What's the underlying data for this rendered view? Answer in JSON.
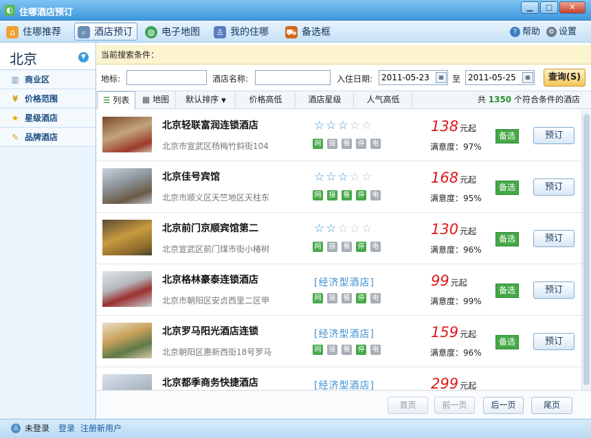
{
  "window": {
    "title": "住哪酒店预订"
  },
  "toolbar": {
    "items": [
      {
        "label": "住哪推荐"
      },
      {
        "label": "酒店预订"
      },
      {
        "label": "电子地图"
      },
      {
        "label": "我的住哪"
      },
      {
        "label": "备选框"
      }
    ],
    "help": "帮助",
    "settings": "设置"
  },
  "sidebar": {
    "city": "北京",
    "items": [
      {
        "label": "商业区"
      },
      {
        "label": "价格范围"
      },
      {
        "label": "星级酒店"
      },
      {
        "label": "品牌酒店"
      }
    ]
  },
  "search": {
    "conditions_label": "当前搜索条件：",
    "landmark_label": "地标:",
    "landmark_value": "",
    "hotel_name_label": "酒店名称:",
    "hotel_name_value": "",
    "checkin_label": "入住日期:",
    "checkin_value": "2011-05-23",
    "to_label": "至",
    "checkout_value": "2011-05-25",
    "button": "查询(S)"
  },
  "tabs": {
    "list": "列表",
    "map": "地图",
    "sort_default": "默认排序",
    "sort_price": "价格高低",
    "sort_star": "酒店星级",
    "sort_popular": "人气高低"
  },
  "result": {
    "prefix": "共",
    "count": "1350",
    "suffix": "个符合条件的酒店"
  },
  "facility_labels": [
    "网",
    "接",
    "餐",
    "停",
    "电"
  ],
  "hotels": [
    {
      "name": "北京轻联富润连锁酒店",
      "address": "北京市宣武区杨梅竹斜街104",
      "stars": 3,
      "type": "",
      "facilities": [
        true,
        false,
        false,
        false,
        false
      ],
      "price": "138",
      "unit": "元起",
      "satisfaction": "满意度：97%",
      "fav": "备选",
      "book": "预订"
    },
    {
      "name": "北京佳号宾馆",
      "address": "北京市顺义区天竺地区天柱东",
      "stars": 3,
      "type": "",
      "facilities": [
        true,
        true,
        true,
        true,
        false
      ],
      "price": "168",
      "unit": "元起",
      "satisfaction": "满意度：95%",
      "fav": "备选",
      "book": "预订"
    },
    {
      "name": "北京前门京顺宾馆第二",
      "address": "北京宣武区前门煤市街小椿树",
      "stars": 2,
      "type": "",
      "facilities": [
        true,
        false,
        false,
        true,
        false
      ],
      "price": "130",
      "unit": "元起",
      "satisfaction": "满意度：96%",
      "fav": "备选",
      "book": "预订"
    },
    {
      "name": "北京格林豪泰连锁酒店",
      "address": "北京市朝阳区安贞西里二区甲",
      "stars": 0,
      "type": "[经济型酒店]",
      "facilities": [
        true,
        false,
        false,
        true,
        false
      ],
      "price": "99",
      "unit": "元起",
      "satisfaction": "满意度：99%",
      "fav": "备选",
      "book": "预订"
    },
    {
      "name": "北京罗马阳光酒店连锁",
      "address": "北京朝阳区惠新西街18号罗马",
      "stars": 0,
      "type": "[经济型酒店]",
      "facilities": [
        true,
        false,
        false,
        true,
        false
      ],
      "price": "159",
      "unit": "元起",
      "satisfaction": "满意度：96%",
      "fav": "备选",
      "book": "预订"
    },
    {
      "name": "北京都季商务快捷酒店",
      "address": "",
      "stars": 0,
      "type": "[经济型酒店]",
      "facilities": [],
      "price": "299",
      "unit": "元起",
      "satisfaction": "",
      "fav": "",
      "book": ""
    }
  ],
  "pager": {
    "first": "首页",
    "prev": "前一页",
    "next": "后一页",
    "last": "尾页"
  },
  "status": {
    "user": "未登录",
    "login": "登录",
    "register": "注册新用户"
  }
}
